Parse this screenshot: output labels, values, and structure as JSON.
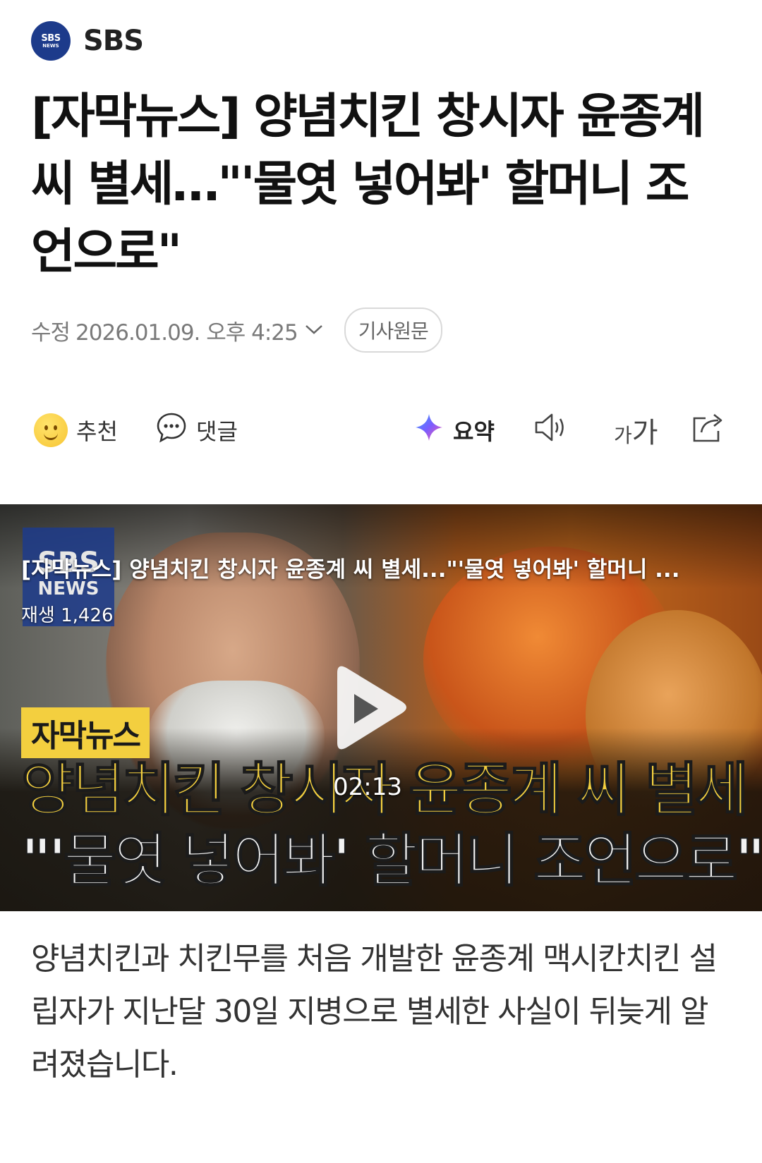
{
  "publisher": {
    "logo_line1": "SBS",
    "logo_line2": "NEWS",
    "name": "SBS"
  },
  "article": {
    "headline": "[자막뉴스] 양념치킨 창시자 윤종계 씨 별세…\"'물엿 넣어봐' 할머니 조언으로\"",
    "meta": {
      "edit_label": "수정",
      "timestamp": "2026.01.09. 오후 4:25",
      "original_button": "기사원문"
    },
    "body": "양념치킨과 치킨무를 처음 개발한 윤종계 맥시칸치킨 설립자가 지난달 30일 지병으로 별세한 사실이 뒤늦게 알려졌습니다."
  },
  "actions": {
    "like_label": "추천",
    "comment_label": "댓글",
    "summary_label": "요약",
    "font_icon_small": "가",
    "font_icon_large": "가"
  },
  "video": {
    "title": "[자막뉴스] 양념치킨 창시자 윤종계 씨 별세...\"'물엿 넣어봐' 할머니 ...",
    "plays": "재생 1,426",
    "duration": "02:13",
    "thumb_logo_line1": "SBS",
    "thumb_logo_line2": "NEWS",
    "thumb_label": "자막뉴스",
    "thumb_caption_line1": "양념치킨 창시자 윤종계 씨 별세",
    "thumb_caption_line2": "\"'물엿 넣어봐' 할머니 조언으로\""
  },
  "colors": {
    "brand": "#1d3b8b",
    "caption_yellow": "#f3cf3f",
    "meta_gray": "#7a7a7a"
  }
}
